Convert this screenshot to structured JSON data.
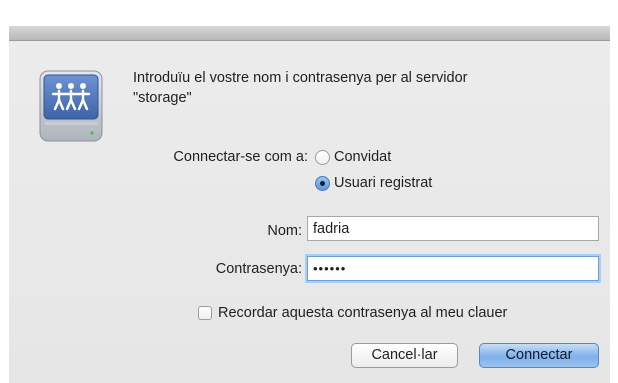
{
  "dialog": {
    "message_line1": "Introduïu el vostre nom i contrasenya per al servidor",
    "message_line2": "\"storage\"",
    "connect_as_label": "Connectar-se com a:",
    "options": [
      {
        "label": "Convidat",
        "selected": false
      },
      {
        "label": "Usuari registrat",
        "selected": true
      }
    ],
    "name_label": "Nom:",
    "name_value": "fadria",
    "password_label": "Contrasenya:",
    "password_masked": "••••••",
    "remember_label": "Recordar aquesta contrasenya al meu clauer",
    "remember_checked": false,
    "cancel_label": "Cancel·lar",
    "connect_label": "Connectar",
    "icon": "network-server-icon"
  },
  "colors": {
    "accent": "#5e96dc",
    "focus_ring": "#a9cdf3",
    "dialog_bg": "#e8e8e8",
    "icon_blue": "#4f78c0"
  }
}
